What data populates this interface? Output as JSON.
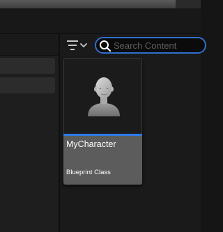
{
  "search": {
    "placeholder": "Search Content",
    "value": ""
  },
  "toolbar": {
    "filter_icon": "filter-lines-icon",
    "dropdown_icon": "chevron-down-icon"
  },
  "assets": [
    {
      "name": "MyCharacter",
      "type": "Blueprint Class",
      "thumbnail_icon": "character-bust-icon"
    }
  ],
  "colors": {
    "accent": "#2e7be6",
    "search_border": "#2f6fcc",
    "card_body": "#5c5c5c",
    "background": "#1a1a1a"
  }
}
